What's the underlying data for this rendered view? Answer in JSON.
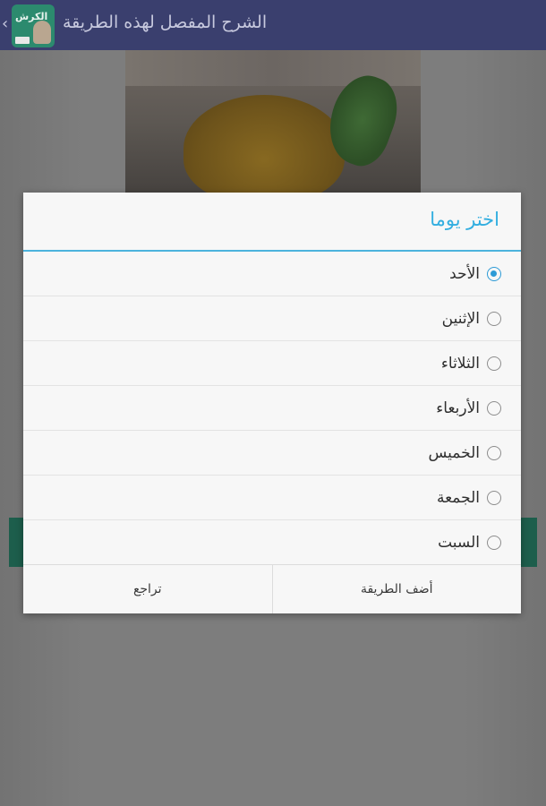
{
  "appbar": {
    "title": "الشرح المفصل لهذه الطريقة",
    "back_icon": "chevron-left-icon",
    "app_icon_text": "الكرش"
  },
  "dialog": {
    "title": "اختر يوما",
    "options": [
      {
        "label": "الأحد",
        "checked": true
      },
      {
        "label": "الإثنين",
        "checked": false
      },
      {
        "label": "الثلاثاء",
        "checked": false
      },
      {
        "label": "الأربعاء",
        "checked": false
      },
      {
        "label": "الخميس",
        "checked": false
      },
      {
        "label": "الجمعة",
        "checked": false
      },
      {
        "label": "السبت",
        "checked": false
      }
    ],
    "cancel_label": "تراجع",
    "add_label": "أضف الطريقة"
  },
  "colors": {
    "accent": "#32aee0",
    "appbar": "#3a3f6e",
    "overlay": "#7b7b7b"
  }
}
